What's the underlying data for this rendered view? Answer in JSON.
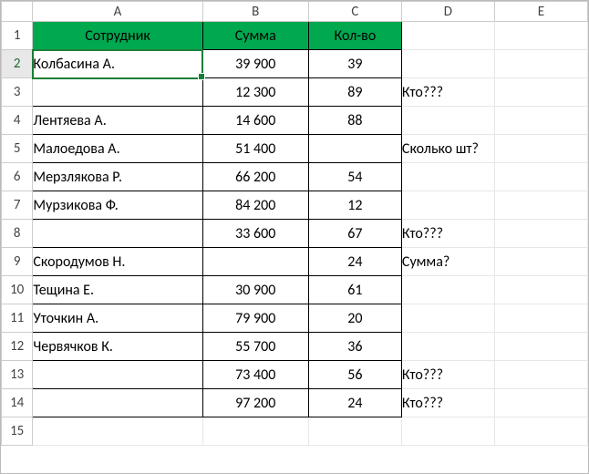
{
  "columns": {
    "row_header": "",
    "A": "A",
    "B": "B",
    "C": "C",
    "D": "D",
    "E": "E"
  },
  "row_headers": [
    "1",
    "2",
    "3",
    "4",
    "5",
    "6",
    "7",
    "8",
    "9",
    "10",
    "11",
    "12",
    "13",
    "14",
    "15"
  ],
  "table": {
    "header": {
      "employee": "Сотрудник",
      "sum": "Сумма",
      "qty": "Кол-во"
    },
    "rows": [
      {
        "employee": "Колбасина А.",
        "sum": "39 900",
        "qty": "39",
        "note": ""
      },
      {
        "employee": "",
        "sum": "12 300",
        "qty": "89",
        "note": "Кто???"
      },
      {
        "employee": "Лентяева А.",
        "sum": "14 600",
        "qty": "88",
        "note": ""
      },
      {
        "employee": "Малоедова А.",
        "sum": "51 400",
        "qty": "",
        "note": "Сколько шт?"
      },
      {
        "employee": "Мерзлякова Р.",
        "sum": "66 200",
        "qty": "54",
        "note": ""
      },
      {
        "employee": "Мурзикова Ф.",
        "sum": "84 200",
        "qty": "12",
        "note": ""
      },
      {
        "employee": "",
        "sum": "33 600",
        "qty": "67",
        "note": "Кто???"
      },
      {
        "employee": "Скородумов Н.",
        "sum": "",
        "qty": "24",
        "note": "Сумма?"
      },
      {
        "employee": "Тещина Е.",
        "sum": "30 900",
        "qty": "61",
        "note": ""
      },
      {
        "employee": "Уточкин А.",
        "sum": "79 900",
        "qty": "20",
        "note": ""
      },
      {
        "employee": "Червячков К.",
        "sum": "55 700",
        "qty": "36",
        "note": ""
      },
      {
        "employee": "",
        "sum": "73 400",
        "qty": "56",
        "note": "Кто???"
      },
      {
        "employee": "",
        "sum": "97 200",
        "qty": "24",
        "note": "Кто???"
      }
    ]
  },
  "selection": {
    "cell": "A2"
  }
}
